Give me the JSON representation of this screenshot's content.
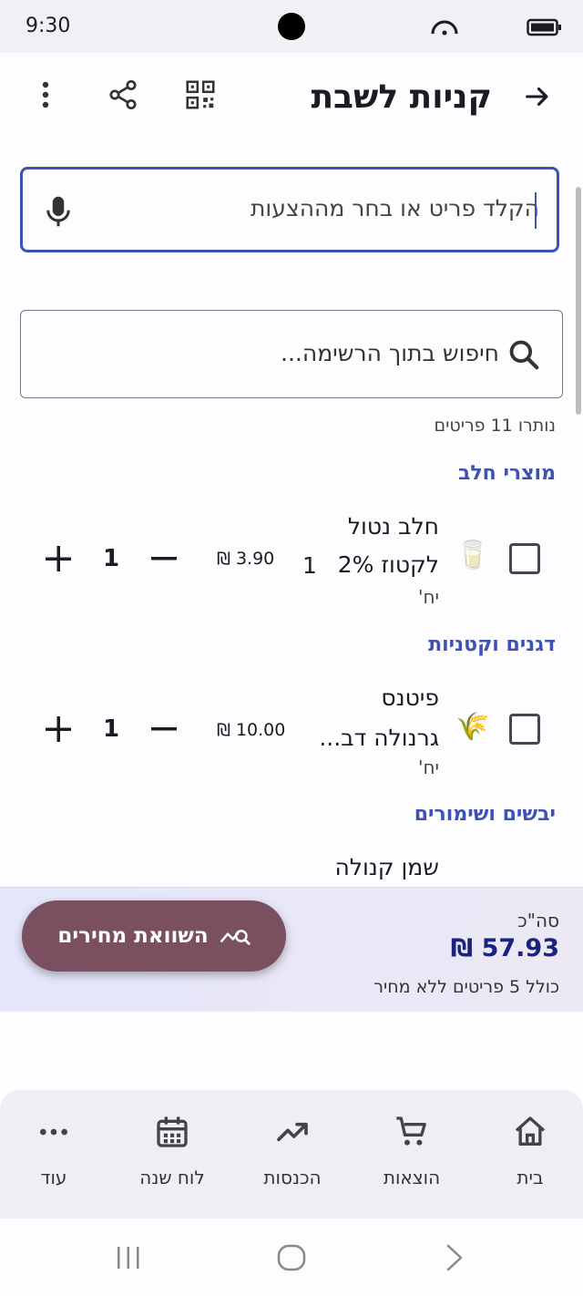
{
  "status": {
    "time": "9:30"
  },
  "header": {
    "title": "קניות לשבת"
  },
  "input": {
    "placeholder": "הקלד פריט או בחר מההצעות"
  },
  "search": {
    "placeholder": "חיפוש בתוך הרשימה..."
  },
  "remaining": "נותרו 11 פריטים",
  "categories": [
    {
      "name": "מוצרי חלב",
      "item": {
        "name_line1": "חלב נטול",
        "name_line2": "לקטוז 2%",
        "name_qty": "1",
        "unit": "יח'",
        "price": "3.90 ₪",
        "qty": "1",
        "emoji": "🥛"
      }
    },
    {
      "name": "דגנים וקטניות",
      "item": {
        "name_line1": "פיטנס",
        "name_line2": "גרנולה דב...",
        "name_qty": "",
        "unit": "יח'",
        "price": "10.00 ₪",
        "qty": "1",
        "emoji": "🌾"
      }
    },
    {
      "name": "יבשים ושימורים",
      "item": {
        "name_line1": "שמן קנולה"
      }
    }
  ],
  "summary": {
    "label": "סה\"כ",
    "total": "57.93 ₪",
    "note": "כולל 5 פריטים ללא מחיר"
  },
  "compare_button": {
    "label": "השוואת מחירים"
  },
  "bottom_nav": [
    {
      "label": "בית",
      "icon": "home-icon"
    },
    {
      "label": "הוצאות",
      "icon": "cart-icon"
    },
    {
      "label": "הכנסות",
      "icon": "trending-up-icon"
    },
    {
      "label": "לוח שנה",
      "icon": "calendar-icon"
    },
    {
      "label": "עוד",
      "icon": "more-horizontal-icon"
    }
  ],
  "colors": {
    "accent": "#3f51b5",
    "compare_button": "#7a5060",
    "total": "#1a237e"
  }
}
